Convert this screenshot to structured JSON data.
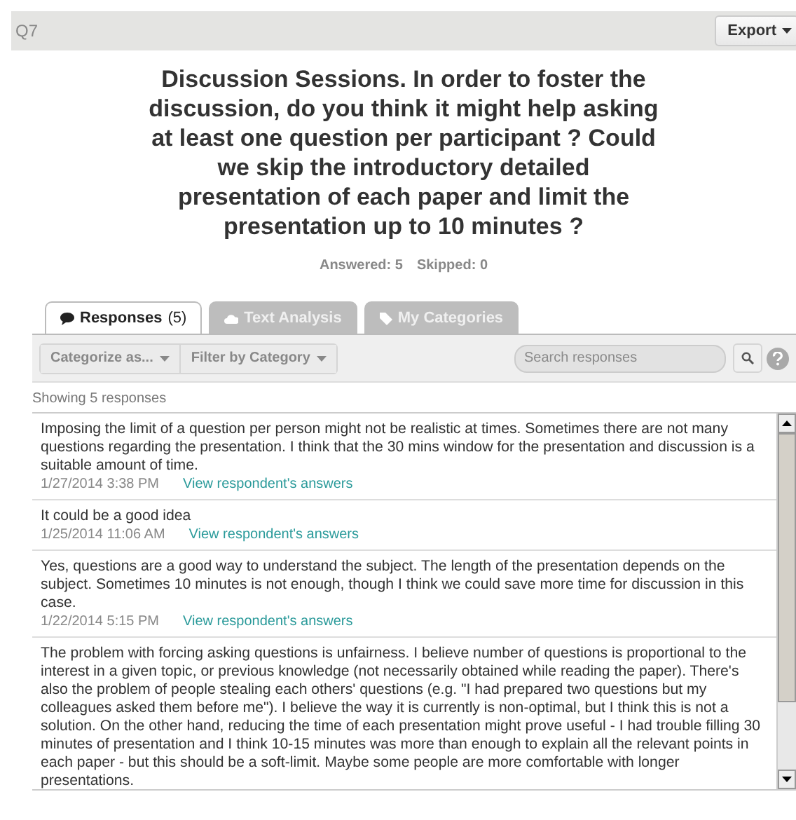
{
  "header": {
    "question": "Q7",
    "export": "Export"
  },
  "title": "Discussion Sessions. In order to foster the discussion, do you think it might help asking at least one question per participant ? Could we skip the introductory detailed presentation of each paper and limit the presentation up to 10 minutes ?",
  "stats": [
    "Answered: 5",
    "Skipped: 0"
  ],
  "tabs": [
    {
      "label": "Responses",
      "count": "(5)",
      "selected": true
    },
    {
      "label": "Text Analysis",
      "selected": false
    },
    {
      "label": "My Categories",
      "selected": false
    }
  ],
  "toolbar": {
    "categorize": "Categorize as...",
    "filter": "Filter by Category",
    "search": {
      "placeholder": "Search responses"
    }
  },
  "showing": "Showing 5 responses",
  "responses": [
    {
      "text": "Imposing the limit of a question per person might not be realistic at times. Sometimes there are not many questions regarding the presentation. I think that the 30 mins window for the presentation and discussion is a suitable amount of time.",
      "date": "1/27/2014 3:38 PM",
      "link": "View respondent's answers"
    },
    {
      "text": "It could be a good idea",
      "date": "1/25/2014 11:06 AM",
      "link": "View respondent's answers"
    },
    {
      "text": "Yes, questions are a good way to understand the subject. The length of the presentation depends on the subject. Sometimes 10 minutes is not enough, though I think we could save more time for discussion in this case.",
      "date": "1/22/2014 5:15 PM",
      "link": "View respondent's answers"
    },
    {
      "text": "The problem with forcing asking questions is unfairness. I believe number of questions is proportional to the interest in a given topic, or previous knowledge (not necessarily obtained while reading the paper). There's also the problem of people stealing each others' questions (e.g. \"I had prepared two questions but my colleagues asked them before me\"). I believe the way it is currently is non-optimal, but I think this is not a solution. On the other hand, reducing the time of each presentation might prove useful - I had trouble filling 30 minutes of presentation and I think 10-15 minutes was more than enough to explain all the relevant points in each paper - but this should be a soft-limit. Maybe some people are more comfortable with longer presentations."
    }
  ]
}
